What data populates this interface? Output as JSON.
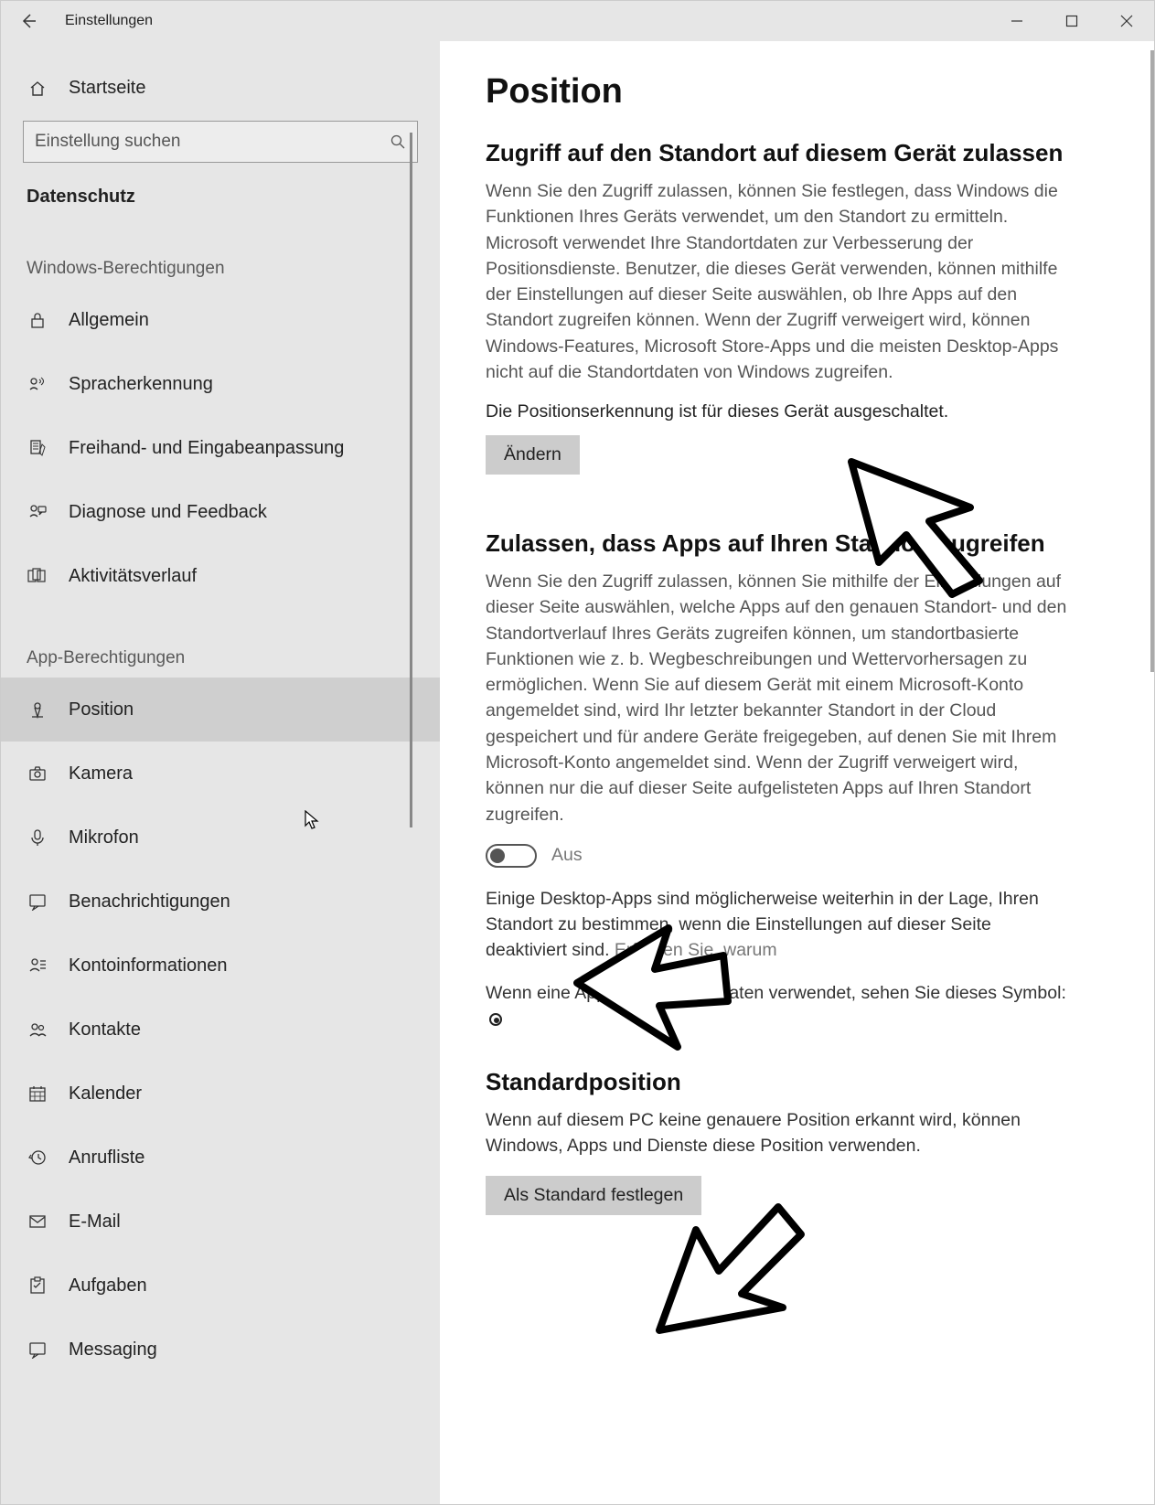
{
  "titlebar": {
    "title": "Einstellungen"
  },
  "sidebar": {
    "home": "Startseite",
    "search_placeholder": "Einstellung suchen",
    "category": "Datenschutz",
    "group1": "Windows-Berechtigungen",
    "items1": [
      {
        "label": "Allgemein"
      },
      {
        "label": "Spracherkennung"
      },
      {
        "label": "Freihand- und Eingabeanpassung"
      },
      {
        "label": "Diagnose und Feedback"
      },
      {
        "label": "Aktivitätsverlauf"
      }
    ],
    "group2": "App-Berechtigungen",
    "items2": [
      {
        "label": "Position"
      },
      {
        "label": "Kamera"
      },
      {
        "label": "Mikrofon"
      },
      {
        "label": "Benachrichtigungen"
      },
      {
        "label": "Kontoinformationen"
      },
      {
        "label": "Kontakte"
      },
      {
        "label": "Kalender"
      },
      {
        "label": "Anrufliste"
      },
      {
        "label": "E-Mail"
      },
      {
        "label": "Aufgaben"
      },
      {
        "label": "Messaging"
      }
    ]
  },
  "main": {
    "page_title": "Position",
    "s1_heading": "Zugriff auf den Standort auf diesem Gerät zulassen",
    "s1_body": "Wenn Sie den Zugriff zulassen, können Sie festlegen, dass Windows die Funktionen Ihres Geräts verwendet, um den Standort zu ermitteln. Microsoft verwendet Ihre Standortdaten zur Verbesserung der Positionsdienste. Benutzer, die dieses Gerät verwenden, können mithilfe der Einstellungen auf dieser Seite auswählen, ob Ihre Apps auf den Standort zugreifen können. Wenn der Zugriff verweigert wird, können Windows-Features, Microsoft Store-Apps und die meisten Desktop-Apps nicht auf die Standortdaten von Windows zugreifen.",
    "s1_status": "Die Positionserkennung ist für dieses Gerät ausgeschaltet.",
    "s1_button": "Ändern",
    "s2_heading": "Zulassen, dass Apps auf Ihren Standort zugreifen",
    "s2_body": "Wenn Sie den Zugriff zulassen, können Sie mithilfe der Einstellungen auf dieser Seite auswählen, welche Apps auf den genauen Standort- und den Standortverlauf Ihres Geräts zugreifen können, um standortbasierte Funktionen wie z. b. Wegbeschreibungen und Wettervorhersagen zu ermöglichen. Wenn Sie auf diesem Gerät mit einem Microsoft-Konto angemeldet sind, wird Ihr letzter bekannter Standort in der Cloud gespeichert und für andere Geräte freigegeben, auf denen Sie mit Ihrem Microsoft-Konto angemeldet sind. Wenn der Zugriff verweigert wird, können nur die auf dieser Seite aufgelisteten Apps auf Ihren Standort zugreifen.",
    "toggle_state": "Aus",
    "s2_note": "Einige Desktop-Apps sind möglicherweise weiterhin in der Lage, Ihren Standort zu bestimmen, wenn die Einstellungen auf dieser Seite deaktiviert sind. ",
    "s2_link": "Erfahren Sie, warum",
    "s2_symbol": "Wenn eine App Ihre Positionsdaten verwendet, sehen Sie dieses Symbol: ",
    "s3_heading": "Standardposition",
    "s3_body": "Wenn auf diesem PC keine genauere Position erkannt wird, können Windows, Apps und Dienste diese Position verwenden.",
    "s3_button": "Als Standard festlegen"
  }
}
